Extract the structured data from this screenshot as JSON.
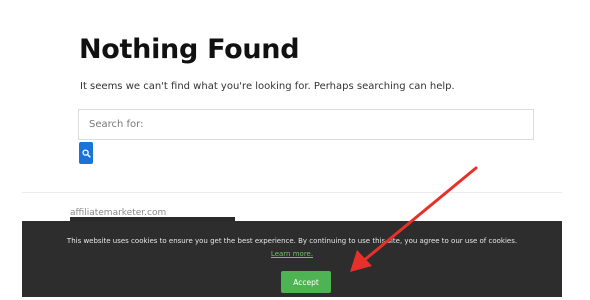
{
  "page": {
    "title": "Nothing Found",
    "message": "It seems we can't find what you're looking for. Perhaps searching can help."
  },
  "search": {
    "placeholder": "Search for:",
    "button_icon": "search-icon"
  },
  "footer": {
    "partial_text": "affiliatemarketer.com"
  },
  "cookie_notice": {
    "message": "This website uses cookies to ensure you get the best experience. By continuing to use this site, you agree to our use of cookies.",
    "learn_more": "Learn more.",
    "accept_label": "Accept"
  },
  "colors": {
    "accent": "#1a73d8",
    "accept": "#4eb453",
    "link": "#6fc26a",
    "cookie_bar": "#2d2d2d",
    "annotation_arrow": "#e8302a"
  }
}
